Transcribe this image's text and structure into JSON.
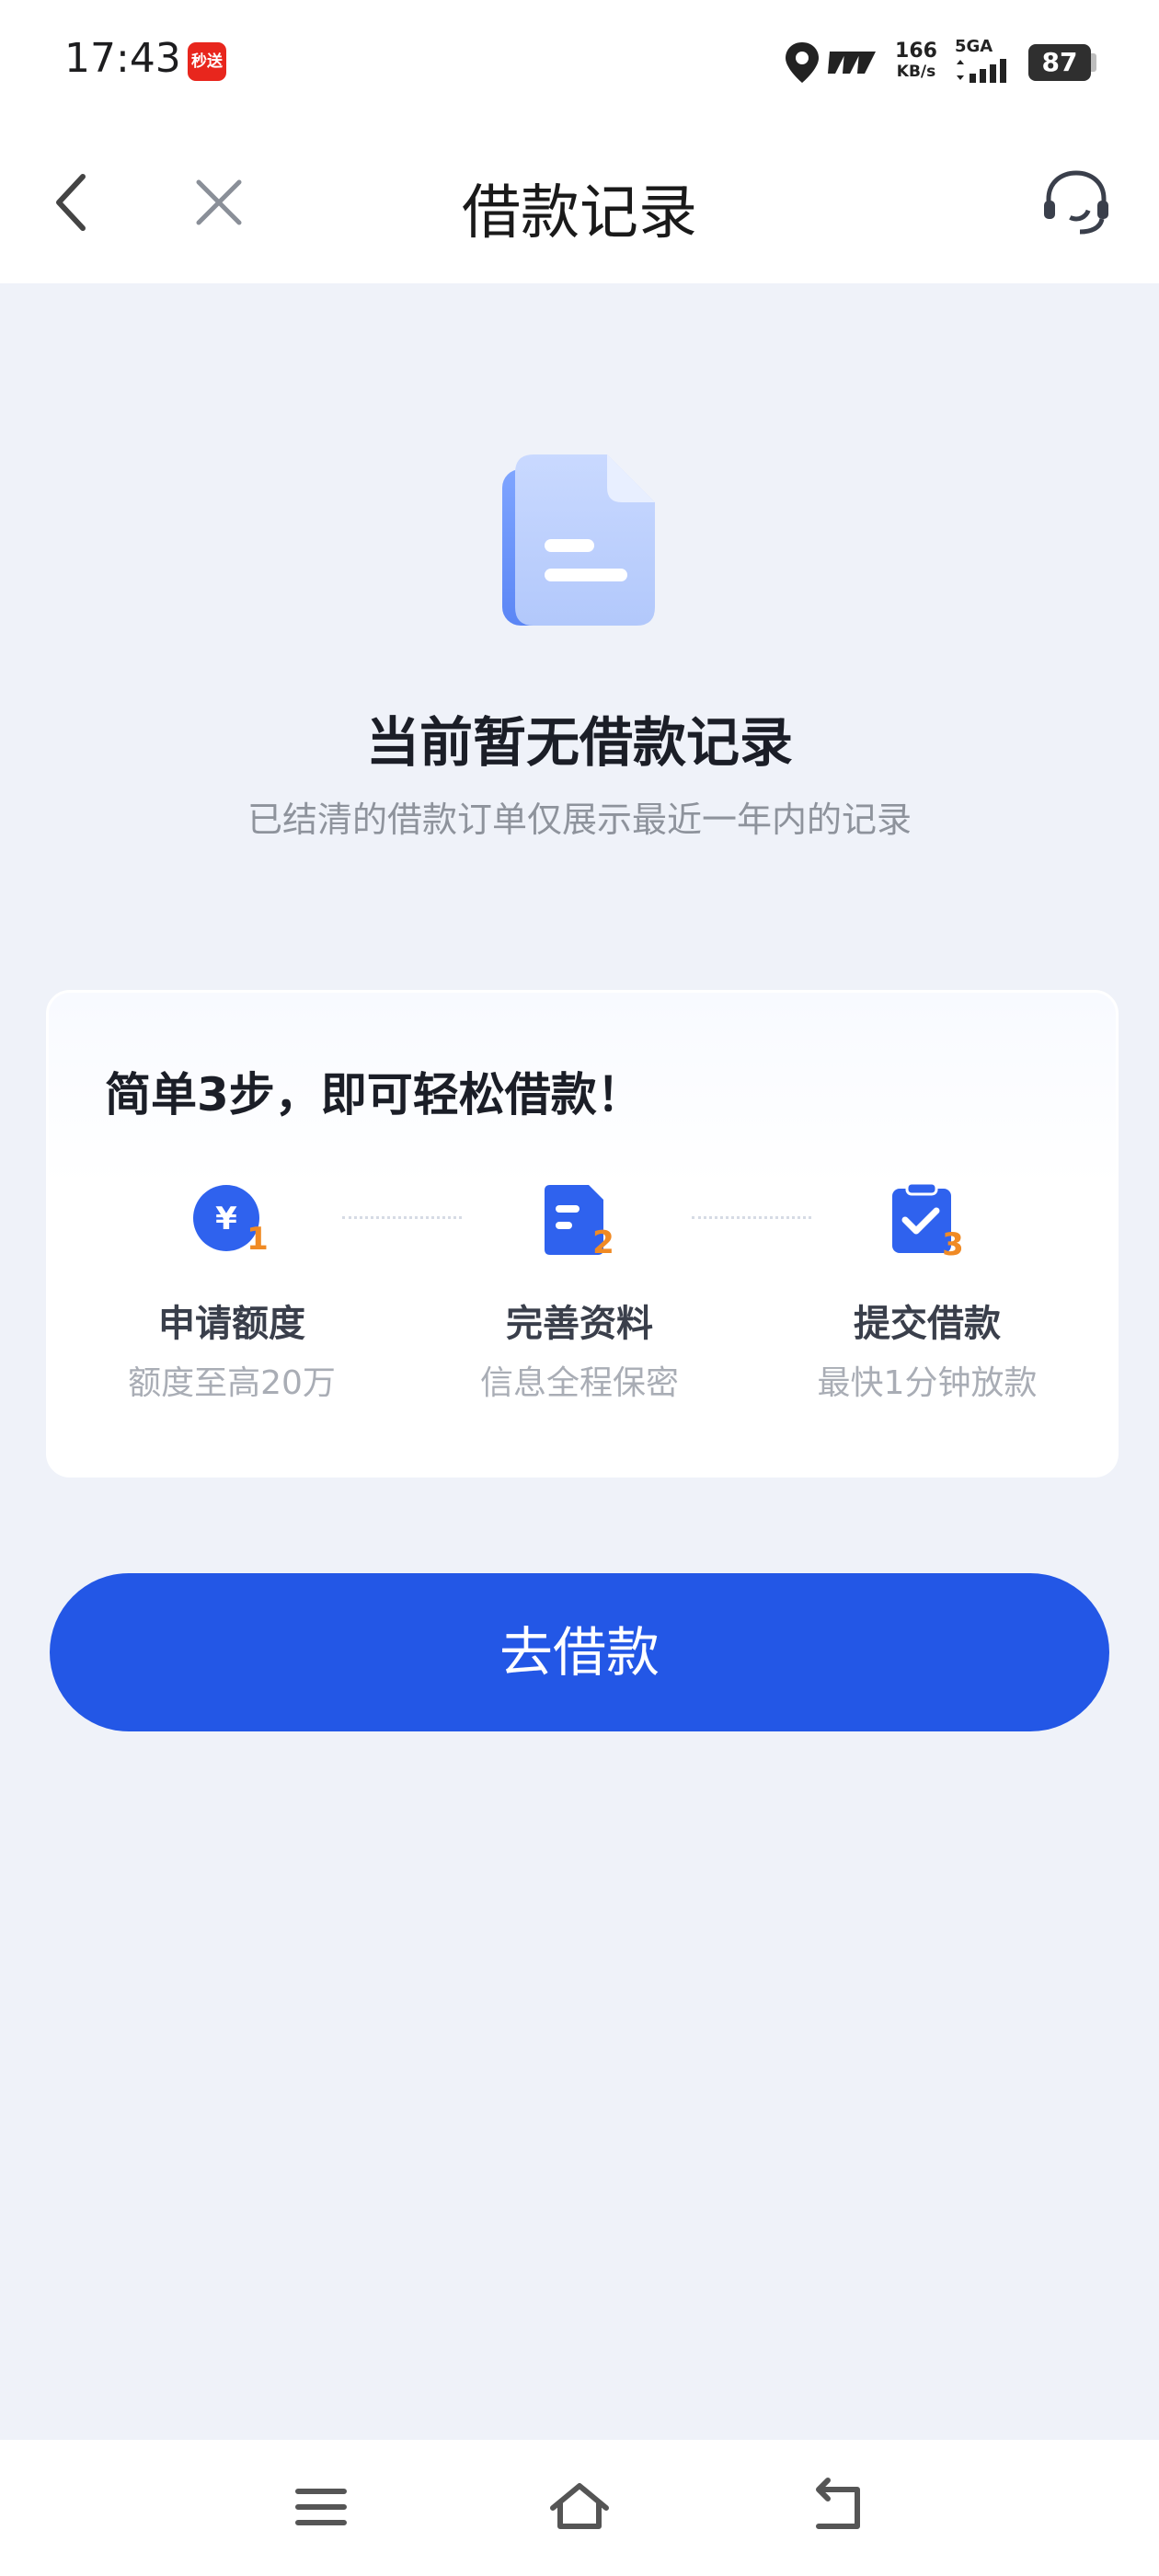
{
  "status_bar": {
    "time": "17:43",
    "app_badge": "秒送",
    "speed_value": "166",
    "speed_unit": "KB/s",
    "network": "5GA",
    "battery": "87"
  },
  "nav": {
    "title": "借款记录"
  },
  "empty_state": {
    "title": "当前暂无借款记录",
    "subtitle": "已结清的借款订单仅展示最近一年内的记录"
  },
  "steps": {
    "title": "简单3步，即可轻松借款！",
    "items": [
      {
        "number": "1",
        "label": "申请额度",
        "desc": "额度至高20万",
        "icon": "yuan-coin-icon"
      },
      {
        "number": "2",
        "label": "完善资料",
        "desc": "信息全程保密",
        "icon": "document-icon"
      },
      {
        "number": "3",
        "label": "提交借款",
        "desc": "最快1分钟放款",
        "icon": "clipboard-check-icon"
      }
    ]
  },
  "primary_button": {
    "label": "去借款"
  },
  "colors": {
    "primary": "#2357e6",
    "step_number": "#f08a24",
    "background": "#eff2f9"
  }
}
